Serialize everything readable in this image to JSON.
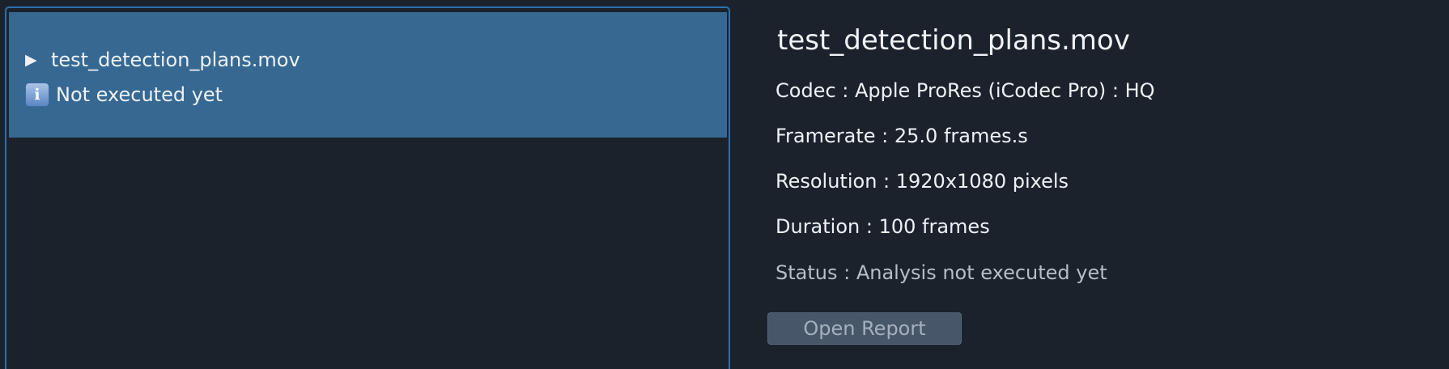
{
  "file_list": {
    "items": [
      {
        "disclosure_glyph": "▶",
        "filename": "test_detection_plans.mov",
        "status_icon": "info-icon",
        "status_icon_glyph": "i",
        "status_text": "Not executed yet"
      }
    ]
  },
  "details": {
    "title": "test_detection_plans.mov",
    "codec": "Codec : Apple ProRes (iCodec Pro) : HQ",
    "framerate": "Framerate : 25.0 frames.s",
    "resolution": "Resolution : 1920x1080 pixels",
    "duration": "Duration : 100 frames",
    "status": "Status : Analysis not executed yet"
  },
  "actions": {
    "open_report_label": "Open Report"
  },
  "colors": {
    "background": "#1b222c",
    "selection": "#366892",
    "focus_border": "#2d6fae",
    "button_bg": "#48566a",
    "button_text": "#a5b0bf"
  }
}
